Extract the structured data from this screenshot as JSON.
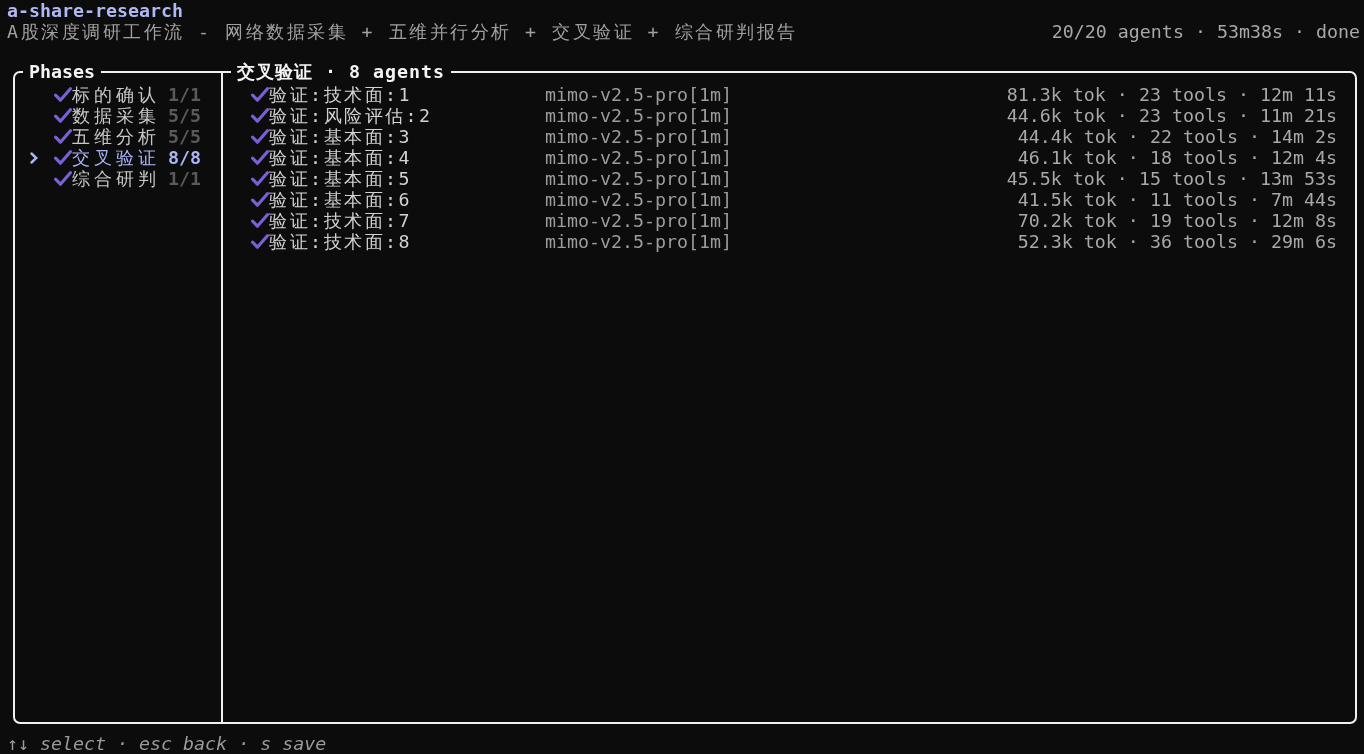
{
  "header": {
    "title": "a-share-research",
    "subtitle": "A股深度调研工作流 - 网络数据采集 + 五维并行分析 + 交叉验证 + 综合研判报告",
    "status": "20/20 agents · 53m38s · done"
  },
  "phases": {
    "title": "Phases",
    "items": [
      {
        "label": "标的确认",
        "count": "1/1",
        "done": true,
        "selected": false
      },
      {
        "label": "数据采集",
        "count": "5/5",
        "done": true,
        "selected": false
      },
      {
        "label": "五维分析",
        "count": "5/5",
        "done": true,
        "selected": false
      },
      {
        "label": "交叉验证",
        "count": "8/8",
        "done": true,
        "selected": true
      },
      {
        "label": "综合研判",
        "count": "1/1",
        "done": true,
        "selected": false
      }
    ]
  },
  "agents": {
    "title": "交叉验证 · 8 agents",
    "items": [
      {
        "name": "验证:技术面:1",
        "model": "mimo-v2.5-pro[1m]",
        "stats": "81.3k tok · 23 tools · 12m 11s",
        "done": true
      },
      {
        "name": "验证:风险评估:2",
        "model": "mimo-v2.5-pro[1m]",
        "stats": "44.6k tok · 23 tools · 11m 21s",
        "done": true
      },
      {
        "name": "验证:基本面:3",
        "model": "mimo-v2.5-pro[1m]",
        "stats": "44.4k tok · 22 tools · 14m 2s",
        "done": true
      },
      {
        "name": "验证:基本面:4",
        "model": "mimo-v2.5-pro[1m]",
        "stats": "46.1k tok · 18 tools · 12m 4s",
        "done": true
      },
      {
        "name": "验证:基本面:5",
        "model": "mimo-v2.5-pro[1m]",
        "stats": "45.5k tok · 15 tools · 13m 53s",
        "done": true
      },
      {
        "name": "验证:基本面:6",
        "model": "mimo-v2.5-pro[1m]",
        "stats": "41.5k tok · 11 tools · 7m 44s",
        "done": true
      },
      {
        "name": "验证:技术面:7",
        "model": "mimo-v2.5-pro[1m]",
        "stats": "70.2k tok · 19 tools · 12m 8s",
        "done": true
      },
      {
        "name": "验证:技术面:8",
        "model": "mimo-v2.5-pro[1m]",
        "stats": "52.3k tok · 36 tools · 29m 6s",
        "done": true
      }
    ]
  },
  "footer": "↑↓ select · esc back · s save"
}
